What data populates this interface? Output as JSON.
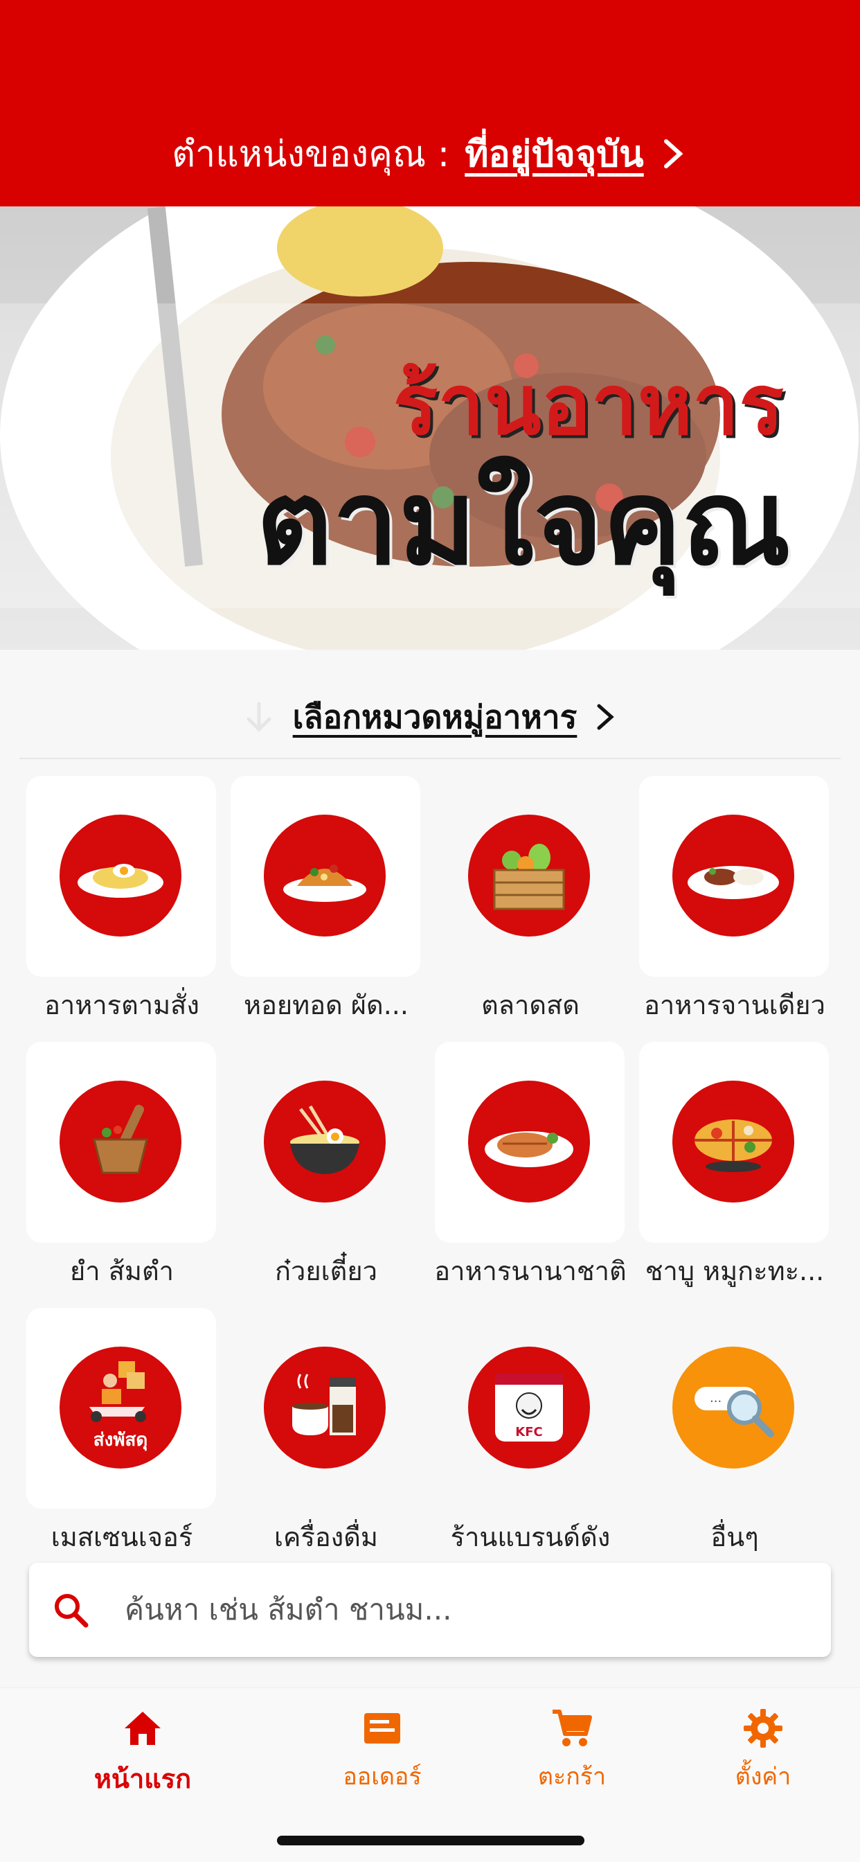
{
  "header": {
    "location_label": "ตำแหน่งของคุณ :",
    "location_value": "ที่อยู่ปัจจุบัน"
  },
  "banner": {
    "line1": "ร้านอาหาร",
    "line2": "ตามใจคุณ"
  },
  "section": {
    "title": "เลือกหมวดหมู่อาหาร"
  },
  "categories": [
    {
      "label": "อาหารตามสั่ง",
      "icon": "fried-rice-plate-icon"
    },
    {
      "label": "หอยทอด ผัด...",
      "icon": "pad-thai-plate-icon"
    },
    {
      "label": "ตลาดสด",
      "icon": "vegetable-crate-icon"
    },
    {
      "label": "อาหารจานเดียว",
      "icon": "duck-rice-plate-icon"
    },
    {
      "label": "ยำ ส้มตำ",
      "icon": "mortar-pestle-icon"
    },
    {
      "label": "ก๋วยเตี๋ยว",
      "icon": "noodle-bowl-icon"
    },
    {
      "label": "อาหารนานาชาติ",
      "icon": "steak-plate-icon"
    },
    {
      "label": "ชาบู หมูกะทะ...",
      "icon": "hotpot-icon"
    },
    {
      "label": "เมสเซนเจอร์",
      "icon": "delivery-scooter-icon",
      "icon_text": "ส่งพัสดุ"
    },
    {
      "label": "เครื่องดื่ม",
      "icon": "coffee-cup-icon"
    },
    {
      "label": "ร้านแบรนด์ดัง",
      "icon": "kfc-logo-icon",
      "icon_text": "KFC"
    },
    {
      "label": "อื่นๆ",
      "icon": "search-magnifier-icon",
      "icon_text": "..."
    }
  ],
  "search": {
    "placeholder": "ค้นหา เช่น ส้มตำ ชานม..."
  },
  "tabbar": {
    "items": [
      {
        "label": "หน้าแรก",
        "icon": "home-icon",
        "active": true
      },
      {
        "label": "ออเดอร์",
        "icon": "order-icon",
        "active": false
      },
      {
        "label": "ตะกร้า",
        "icon": "cart-icon",
        "active": false
      },
      {
        "label": "ตั้งค่า",
        "icon": "settings-icon",
        "active": false
      }
    ]
  },
  "colors": {
    "primary": "#d90000",
    "accent": "#f06700",
    "other_circle": "#f7920a"
  }
}
